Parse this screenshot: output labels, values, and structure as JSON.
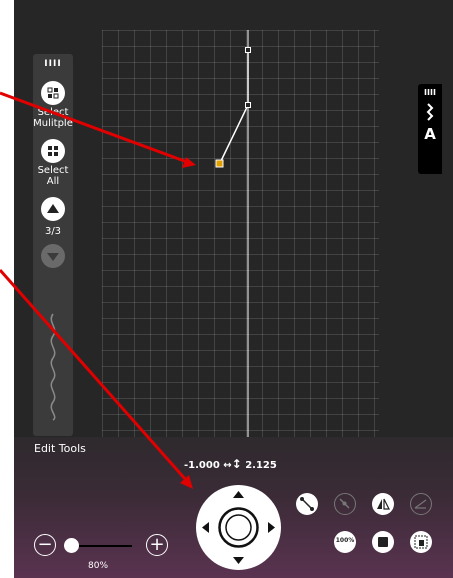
{
  "left_panel": {
    "select_multiple_label": "Select Mulitple",
    "select_all_label": "Select All",
    "page_indicator": "3/3"
  },
  "edit_tools": {
    "title": "Edit Tools",
    "coord_x": "-1.000",
    "coord_y": "2.125",
    "zoom_label": "80%",
    "zoom_level": 0.1,
    "zoom_minus": "−",
    "zoom_plus": "+",
    "scale_100": "100%"
  },
  "right_panel": {
    "letter": "A"
  },
  "colors": {
    "background": "#262626",
    "panel": "#3b3b3b",
    "edit_gradient_bottom": "#5a3350",
    "annotation_arrow": "#e00000",
    "selected_point": "#e0a000"
  }
}
